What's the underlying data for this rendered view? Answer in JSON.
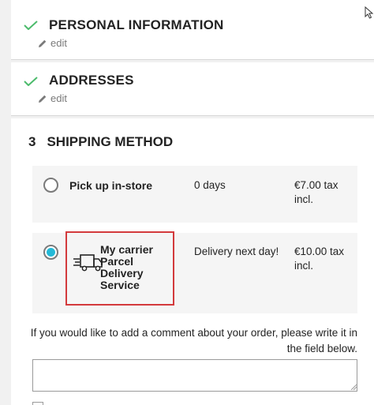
{
  "steps": {
    "personal": {
      "title": "PERSONAL INFORMATION",
      "edit_label": "edit"
    },
    "addresses": {
      "title": "ADDRESSES",
      "edit_label": "edit"
    },
    "shipping": {
      "number": "3",
      "title": "SHIPPING METHOD"
    }
  },
  "carriers": [
    {
      "name": "Pick up in-store",
      "delay": "0 days",
      "price": "€7.00 tax incl.",
      "selected": false
    },
    {
      "name": "My carrier Parcel Delivery Service",
      "delay": "Delivery next day!",
      "price": "€10.00 tax incl.",
      "selected": true
    }
  ],
  "comment": {
    "label": "If you would like to add a comment about your order, please write it in the field below.",
    "value": ""
  },
  "icons": {
    "check": "check-icon",
    "edit": "pencil-icon",
    "carrier_logo": "truck-icon"
  },
  "colors": {
    "check": "#4cbb6c",
    "radio_selected": "#24b9d7",
    "highlight": "#d33a3c"
  }
}
